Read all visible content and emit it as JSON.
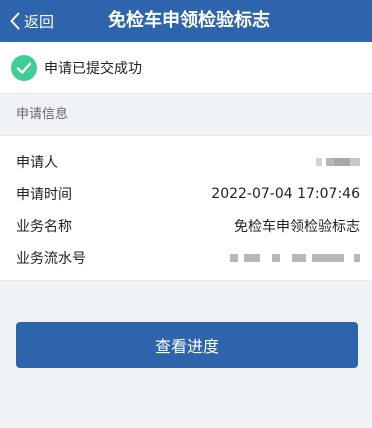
{
  "header": {
    "back_label": "返回",
    "title": "免检车申领检验标志",
    "color": "#2d64ab"
  },
  "status": {
    "icon": "check-circle-icon",
    "text": "申请已提交成功",
    "color": "#3fcf94"
  },
  "section": {
    "title": "申请信息"
  },
  "info": {
    "rows": [
      {
        "label": "申请人",
        "value": ""
      },
      {
        "label": "申请时间",
        "value": "2022-07-04 17:07:46"
      },
      {
        "label": "业务名称",
        "value": "免检车申领检验标志"
      },
      {
        "label": "业务流水号",
        "value": ""
      }
    ]
  },
  "action": {
    "button_label": "查看进度"
  }
}
